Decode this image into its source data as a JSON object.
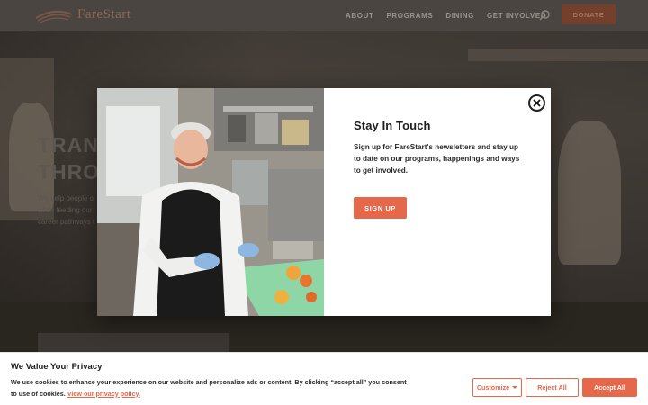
{
  "header": {
    "logo_text": "FareStart",
    "nav": [
      "ABOUT",
      "PROGRAMS",
      "DINING",
      "GET INVOLVED"
    ],
    "donate_label": "DONATE",
    "search_icon": "search-icon"
  },
  "hero": {
    "title_lines": [
      "TRANS",
      "THROU"
    ],
    "subtitle_lines": [
      "We help people o",
      "while feeding our",
      "career pathways t"
    ]
  },
  "modal": {
    "title": "Stay In Touch",
    "body": "Sign up for FareStart's newsletters and stay up to date on our programs, happenings and ways to get involved.",
    "signup_label": "SIGN UP",
    "close_icon": "close-icon"
  },
  "cookie": {
    "title": "We Value Your Privacy",
    "text": "We use cookies to enhance your experience on our website and personalize ads or content. By clicking “accept all” you consent to use of cookies.",
    "link_text": "View our privacy policy.",
    "customize_label": "Customize",
    "reject_label": "Reject All",
    "accept_label": "Accept All"
  },
  "colors": {
    "accent": "#e5684a",
    "overlay_header": "#4a4540",
    "donate_dimmed": "#74402c"
  }
}
